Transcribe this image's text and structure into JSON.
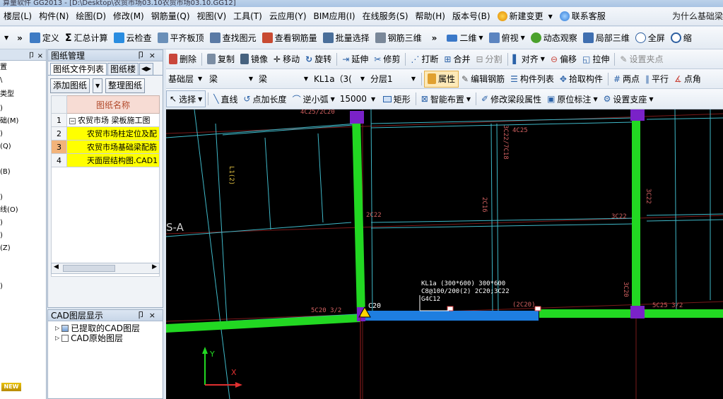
{
  "titlebar": {
    "text": "算量软件 GG2013 - [D:\\Desktop\\农贸市场03.10农贸市场03.10.GG12]"
  },
  "menu": {
    "items": [
      "楼层(L)",
      "构件(N)",
      "绘图(D)",
      "修改(M)",
      "钢筋量(Q)",
      "视图(V)",
      "工具(T)",
      "云应用(Y)",
      "BIM应用(I)",
      "在线服务(S)",
      "帮助(H)",
      "版本号(B)",
      "新建变更",
      "联系客服"
    ],
    "right_text": "为什么基础梁"
  },
  "toolbar1": {
    "items": [
      "定义",
      "汇总计算",
      "云检查",
      "平齐板顶",
      "查找图元",
      "查看钢筋量",
      "批量选择",
      "钢筋三维",
      "二维",
      "俯视",
      "动态观察",
      "局部三维",
      "全屏",
      "缩"
    ]
  },
  "left_strip": {
    "items": [
      "置",
      "\\",
      "类型",
      ")",
      "础(M)",
      ")",
      "(Q)",
      "",
      "(B)",
      "",
      ")",
      "线(O)",
      ")",
      ")",
      "(Z)",
      "",
      "",
      ")"
    ],
    "badge": "NEW"
  },
  "drawing_panel": {
    "title": "图纸管理",
    "tabs": [
      "图纸文件列表",
      "图纸楼"
    ],
    "add_button": "添加图纸",
    "organize_button": "整理图纸",
    "table_header": "图纸名称",
    "rows": [
      {
        "num": "1",
        "name": "农贸市场 梁板施工图"
      },
      {
        "num": "2",
        "name": "农贸市场柱定位及配"
      },
      {
        "num": "3",
        "name": "农贸市场基础梁配筋"
      },
      {
        "num": "4",
        "name": "天面层结构图.CAD1"
      }
    ]
  },
  "cad_panel": {
    "title": "CAD图层显示",
    "items": [
      "已提取的CAD图层",
      "CAD原始图层"
    ]
  },
  "toolbar_edit": {
    "items": [
      "删除",
      "复制",
      "镜像",
      "移动",
      "旋转",
      "延伸",
      "修剪",
      "打断",
      "合并",
      "分割",
      "对齐",
      "偏移",
      "拉伸",
      "设置夹点"
    ]
  },
  "toolbar_select": {
    "floor": "基础层",
    "category": "梁",
    "type": "梁",
    "element": "KL1a（3(",
    "layer": "分层1",
    "buttons": [
      "属性",
      "编辑钢筋",
      "构件列表",
      "拾取构件",
      "两点",
      "平行",
      "点角"
    ]
  },
  "toolbar_draw": {
    "items": [
      "选择",
      "直线",
      "点加长度",
      "逆小弧",
      "15000",
      "矩形",
      "智能布置",
      "修改梁段属性",
      "原位标注",
      "设置支座"
    ]
  },
  "canvas": {
    "labels": {
      "top_left": "4C25/2C20",
      "axis_label": "S-A",
      "l1": "L1(2)",
      "v_3c22_7c18": "3C22/7C18",
      "h_4c25": "4C25",
      "v_2c16": "2C16",
      "h_2c22": "2C22",
      "h_3c22": "3C22",
      "v_3c22": "3C22",
      "v_3c20": "3C20",
      "bottom_left": "5C20 3/2",
      "bottom_right": "5C25 3/2",
      "c20": "C20",
      "kl_line1": "KL1a (300*600) 300*600",
      "kl_line2": "C8@100/200(2) 2C20;3C22",
      "kl_line3": "G4C12",
      "paren_2c20": "(2C20)",
      "y_axis": "Y",
      "x_axis": "X"
    }
  }
}
